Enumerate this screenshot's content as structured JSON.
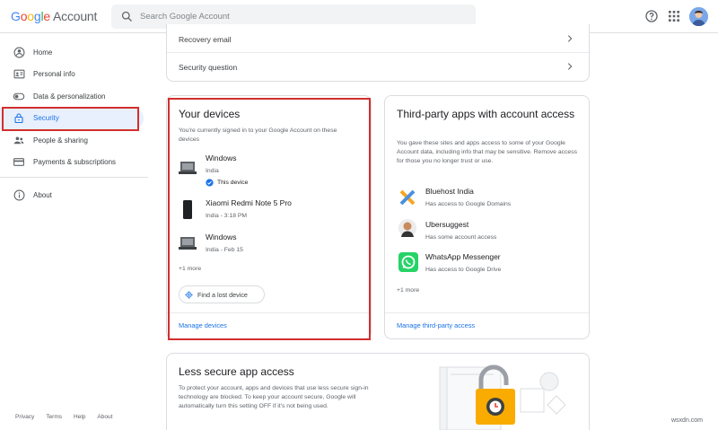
{
  "header": {
    "logo_google": [
      "G",
      "o",
      "o",
      "g",
      "l",
      "e"
    ],
    "logo_account": "Account",
    "search_placeholder": "Search Google Account"
  },
  "sidebar": {
    "items": [
      {
        "label": "Home",
        "icon": "home-icon"
      },
      {
        "label": "Personal info",
        "icon": "id-card-icon"
      },
      {
        "label": "Data & personalization",
        "icon": "toggle-icon"
      },
      {
        "label": "Security",
        "icon": "lock-icon",
        "active": true
      },
      {
        "label": "People & sharing",
        "icon": "people-icon"
      },
      {
        "label": "Payments & subscriptions",
        "icon": "credit-card-icon"
      }
    ],
    "about": "About",
    "footer": [
      "Privacy",
      "Terms",
      "Help",
      "About"
    ]
  },
  "rows": {
    "recovery_email": "Recovery email",
    "security_question": "Security question"
  },
  "devices": {
    "title": "Your devices",
    "description": "You're currently signed in to your Google Account on these devices",
    "list": [
      {
        "name": "Windows",
        "location": "India",
        "badge": "This device",
        "icon": "laptop-icon"
      },
      {
        "name": "Xiaomi Redmi Note 5 Pro",
        "location": "India - 3:18 PM",
        "icon": "phone-icon"
      },
      {
        "name": "Windows",
        "location": "India - Feb 15",
        "icon": "laptop-icon"
      }
    ],
    "more": "+1 more",
    "find_button": "Find a lost device",
    "manage_link": "Manage devices"
  },
  "third_party": {
    "title": "Third-party apps with account access",
    "description": "You gave these sites and apps access to some of your Google Account data, including info that may be sensitive. Remove access for those you no longer trust or use.",
    "apps": [
      {
        "name": "Bluehost India",
        "access": "Has access to Google Domains",
        "icon": "bluehost-icon"
      },
      {
        "name": "Ubersuggest",
        "access": "Has some account access",
        "icon": "ubersuggest-avatar-icon"
      },
      {
        "name": "WhatsApp Messenger",
        "access": "Has access to Google Drive",
        "icon": "whatsapp-icon"
      }
    ],
    "more": "+1 more",
    "manage_link": "Manage third-party access"
  },
  "less_secure": {
    "title": "Less secure app access",
    "description": "To protect your account, apps and devices that use less secure sign-in technology are blocked. To keep your account secure, Google will automatically turn this setting OFF if it's not being used."
  },
  "watermark": "wsxdn.com",
  "colors": {
    "accent": "#1a73e8",
    "highlight_box": "#d32f2f",
    "active_bg": "#e8f0fe"
  }
}
